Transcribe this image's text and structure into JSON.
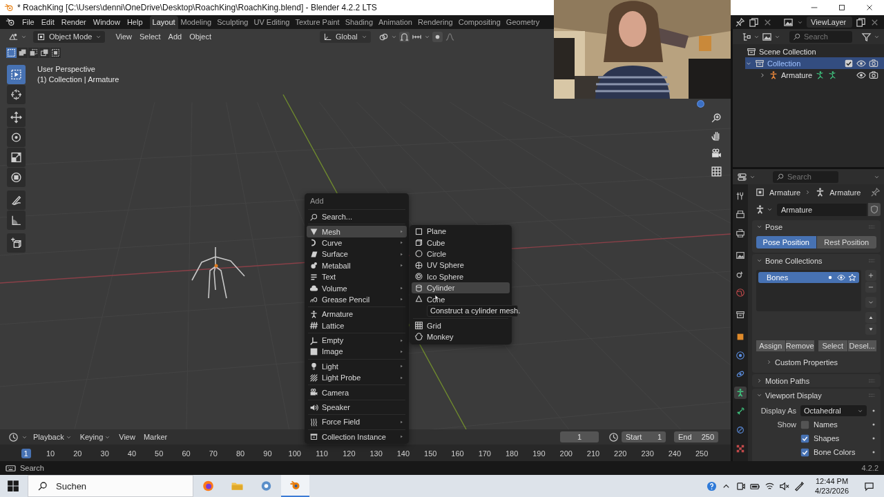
{
  "window": {
    "title": "* RoachKing [C:\\Users\\denni\\OneDrive\\Desktop\\RoachKing\\RoachKing.blend] - Blender 4.2.2 LTS"
  },
  "menubar": [
    "File",
    "Edit",
    "Render",
    "Window",
    "Help"
  ],
  "workspaces": [
    {
      "label": "Layout",
      "selected": true
    },
    {
      "label": "Modeling",
      "selected": false
    },
    {
      "label": "Sculpting",
      "selected": false
    },
    {
      "label": "UV Editing",
      "selected": false
    },
    {
      "label": "Texture Paint",
      "selected": false
    },
    {
      "label": "Shading",
      "selected": false
    },
    {
      "label": "Animation",
      "selected": false
    },
    {
      "label": "Rendering",
      "selected": false
    },
    {
      "label": "Compositing",
      "selected": false
    },
    {
      "label": "Geometry",
      "selected": false
    }
  ],
  "scene": {
    "view_layer": "ViewLayer"
  },
  "viewport": {
    "mode": "Object Mode",
    "menus": [
      "View",
      "Select",
      "Add",
      "Object"
    ],
    "orientation": "Global",
    "select_modes": [
      {
        "selected": true
      },
      {
        "selected": false
      },
      {
        "selected": false
      },
      {
        "selected": false
      },
      {
        "selected": false
      }
    ],
    "tools": [
      {
        "selected": true
      },
      {
        "selected": false
      },
      {
        "selected": false
      },
      {
        "selected": false
      },
      {
        "selected": false
      },
      {
        "selected": false
      },
      {
        "selected": false
      },
      {
        "selected": false
      },
      {
        "selected": false
      }
    ],
    "info": [
      "User Perspective",
      "(1) Collection | Armature"
    ]
  },
  "add_menu": {
    "title": "Add",
    "search": "Search...",
    "groups": [
      [
        {
          "label": "Mesh",
          "submenu": true,
          "selected": true
        },
        {
          "label": "Curve",
          "submenu": true,
          "selected": false
        },
        {
          "label": "Surface",
          "submenu": true,
          "selected": false
        },
        {
          "label": "Metaball",
          "submenu": true,
          "selected": false
        },
        {
          "label": "Text",
          "submenu": false,
          "selected": false
        },
        {
          "label": "Volume",
          "submenu": true,
          "selected": false
        },
        {
          "label": "Grease Pencil",
          "submenu": true,
          "selected": false
        }
      ],
      [
        {
          "label": "Armature",
          "submenu": false,
          "selected": false
        },
        {
          "label": "Lattice",
          "submenu": false,
          "selected": false
        }
      ],
      [
        {
          "label": "Empty",
          "submenu": true,
          "selected": false
        },
        {
          "label": "Image",
          "submenu": true,
          "selected": false
        }
      ],
      [
        {
          "label": "Light",
          "submenu": true,
          "selected": false
        },
        {
          "label": "Light Probe",
          "submenu": true,
          "selected": false
        }
      ],
      [
        {
          "label": "Camera",
          "submenu": false,
          "selected": false
        }
      ],
      [
        {
          "label": "Speaker",
          "submenu": false,
          "selected": false
        }
      ],
      [
        {
          "label": "Force Field",
          "submenu": true,
          "selected": false
        }
      ],
      [
        {
          "label": "Collection Instance",
          "submenu": true,
          "selected": false
        }
      ]
    ]
  },
  "mesh_menu": {
    "groups": [
      [
        {
          "label": "Plane",
          "selected": false
        },
        {
          "label": "Cube",
          "selected": false
        },
        {
          "label": "Circle",
          "selected": false
        },
        {
          "label": "UV Sphere",
          "selected": false
        },
        {
          "label": "Ico Sphere",
          "selected": false
        },
        {
          "label": "Cylinder",
          "selected": true
        },
        {
          "label": "Cone",
          "selected": false
        }
      ],
      [
        {
          "label": "Grid",
          "selected": false
        },
        {
          "label": "Monkey",
          "selected": false
        }
      ]
    ],
    "tooltip": "Construct a cylinder mesh."
  },
  "outliner": {
    "search_placeholder": "Search",
    "tree": [
      {
        "label": "Scene Collection",
        "kind": "root",
        "children": [
          {
            "label": "Collection",
            "kind": "collection",
            "selected": true,
            "expanded": true,
            "checked": true,
            "children": [
              {
                "label": "Armature",
                "kind": "object",
                "selected": false,
                "expanded": false
              }
            ]
          }
        ]
      }
    ]
  },
  "properties": {
    "search_placeholder": "Search",
    "breadcrumb": [
      "Armature",
      "Armature"
    ],
    "name": "Armature",
    "tabs": [
      {
        "selected": false
      },
      {
        "selected": false
      },
      {
        "selected": false
      },
      {
        "selected": false
      },
      {
        "selected": false
      },
      {
        "selected": false
      },
      {
        "selected": false
      },
      {
        "selected": false
      },
      {
        "selected": false
      },
      {
        "selected": false
      },
      {
        "selected": true
      },
      {
        "selected": false
      },
      {
        "selected": false
      },
      {
        "selected": false
      }
    ],
    "panels": [
      {
        "kind": "pose",
        "title": "Pose",
        "expanded": true,
        "options": [
          {
            "label": "Pose Position",
            "selected": true
          },
          {
            "label": "Rest Position",
            "selected": false
          }
        ]
      },
      {
        "kind": "collections",
        "title": "Bone Collections",
        "expanded": true,
        "items": [
          {
            "label": "Bones",
            "selected": true
          }
        ],
        "buttons": [
          "Assign",
          "Remove",
          "Select",
          "Desel..."
        ],
        "subpanels": [
          {
            "title": "Custom Properties",
            "expanded": false
          }
        ]
      },
      {
        "title": "Motion Paths",
        "expanded": false
      },
      {
        "kind": "display",
        "title": "Viewport Display",
        "expanded": true,
        "display_as_label": "Display As",
        "display_as": "Octahedral",
        "show_label": "Show",
        "checks": [
          {
            "label": "Names",
            "checked": false
          },
          {
            "label": "Shapes",
            "checked": true
          },
          {
            "label": "Bone Colors",
            "checked": true
          }
        ]
      }
    ]
  },
  "timeline": {
    "menus": [
      {
        "label": "Playback",
        "dropdown": true
      },
      {
        "label": "Keying",
        "dropdown": true
      },
      {
        "label": "View",
        "dropdown": false
      },
      {
        "label": "Marker",
        "dropdown": false
      }
    ],
    "current_frame": "1",
    "start_label": "Start",
    "start": "1",
    "end_label": "End",
    "end": "250",
    "ruler": [
      {
        "label": "1",
        "selected": true
      },
      {
        "label": "10",
        "selected": false
      },
      {
        "label": "20",
        "selected": false
      },
      {
        "label": "30",
        "selected": false
      },
      {
        "label": "40",
        "selected": false
      },
      {
        "label": "50",
        "selected": false
      },
      {
        "label": "60",
        "selected": false
      },
      {
        "label": "70",
        "selected": false
      },
      {
        "label": "80",
        "selected": false
      },
      {
        "label": "90",
        "selected": false
      },
      {
        "label": "100",
        "selected": false
      },
      {
        "label": "110",
        "selected": false
      },
      {
        "label": "120",
        "selected": false
      },
      {
        "label": "130",
        "selected": false
      },
      {
        "label": "140",
        "selected": false
      },
      {
        "label": "150",
        "selected": false
      },
      {
        "label": "160",
        "selected": false
      },
      {
        "label": "170",
        "selected": false
      },
      {
        "label": "180",
        "selected": false
      },
      {
        "label": "190",
        "selected": false
      },
      {
        "label": "200",
        "selected": false
      },
      {
        "label": "210",
        "selected": false
      },
      {
        "label": "220",
        "selected": false
      },
      {
        "label": "230",
        "selected": false
      },
      {
        "label": "240",
        "selected": false
      },
      {
        "label": "250",
        "selected": false
      }
    ]
  },
  "status_bar": {
    "hint": "Search",
    "version": "4.2.2"
  },
  "taskbar": {
    "search_placeholder": "Suchen",
    "apps": [
      {
        "selected": false
      },
      {
        "selected": false
      },
      {
        "selected": false
      },
      {
        "selected": true
      }
    ],
    "time": "12:44 PM",
    "date": "4/23/2026"
  }
}
